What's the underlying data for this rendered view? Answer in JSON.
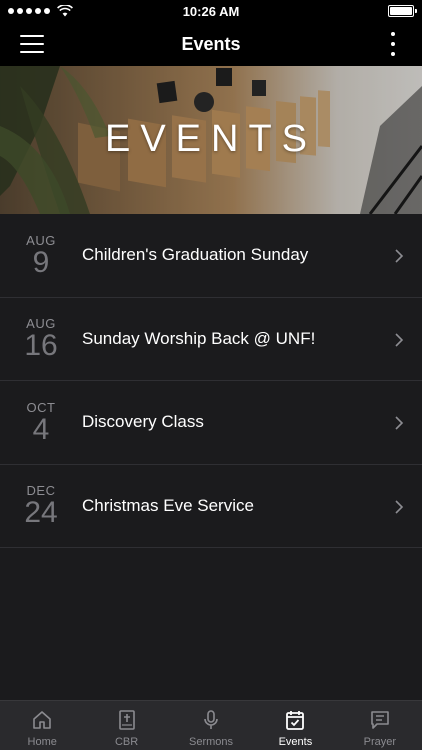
{
  "status_bar": {
    "time": "10:26 AM"
  },
  "nav": {
    "title": "Events"
  },
  "hero": {
    "title": "EVENTS"
  },
  "events": [
    {
      "month": "AUG",
      "day": "9",
      "title": "Children's Graduation Sunday"
    },
    {
      "month": "AUG",
      "day": "16",
      "title": "Sunday Worship Back @ UNF!"
    },
    {
      "month": "OCT",
      "day": "4",
      "title": "Discovery Class"
    },
    {
      "month": "DEC",
      "day": "24",
      "title": "Christmas Eve Service"
    }
  ],
  "tabs": [
    {
      "label": "Home",
      "icon": "home-icon"
    },
    {
      "label": "CBR",
      "icon": "bible-icon"
    },
    {
      "label": "Sermons",
      "icon": "microphone-icon"
    },
    {
      "label": "Events",
      "icon": "calendar-icon",
      "active": true
    },
    {
      "label": "Prayer",
      "icon": "chat-bubble-icon"
    }
  ],
  "colors": {
    "background": "#1b1b1d",
    "bar": "#000000",
    "tab_bar": "#2a2a2d",
    "muted_text": "#8d8d92"
  }
}
